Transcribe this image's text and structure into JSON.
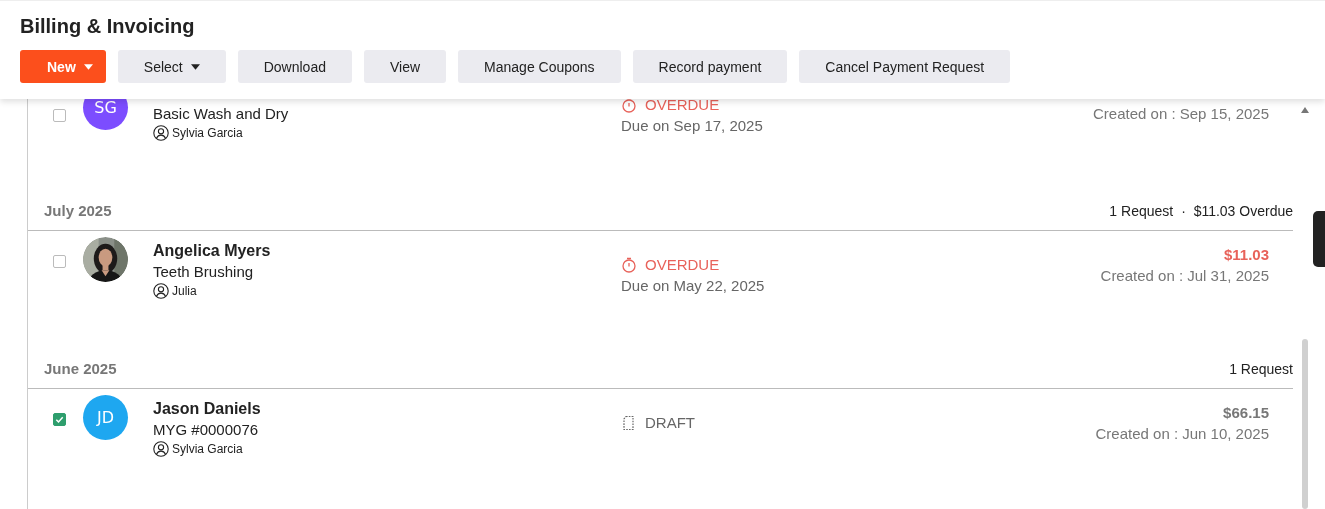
{
  "title": "Billing & Invoicing",
  "buttons": [
    {
      "label": "New",
      "kind": "primary"
    },
    {
      "label": "Select",
      "kind": "dropdown"
    },
    {
      "label": "Download",
      "kind": "plain"
    },
    {
      "label": "View",
      "kind": "plain"
    },
    {
      "label": "Manage Coupons",
      "kind": "plain"
    },
    {
      "label": "Record payment",
      "kind": "plain"
    },
    {
      "label": "Cancel Payment Request",
      "kind": "plain"
    }
  ],
  "leading_items": [
    {
      "checked": false,
      "avatar": {
        "kind": "initials",
        "initials": "SG",
        "color": "#7c4dff"
      },
      "service": "Basic Wash and Dry",
      "assignee": "Sylvia Garcia",
      "status": {
        "kind": "overdue",
        "label": "OVERDUE"
      },
      "due": "Due on Sep 17, 2025",
      "created": "Created on : Sep 15, 2025"
    }
  ],
  "groups": [
    {
      "month": "July 2025",
      "count": "1 Request",
      "overdue": "·  $11.03 Overdue",
      "items": [
        {
          "checked": false,
          "name": "Angelica Myers",
          "service": "Teeth Brushing",
          "assignee": "Julia",
          "status": {
            "kind": "overdue",
            "label": "OVERDUE"
          },
          "due": "Due on May 22, 2025",
          "amount": "$11.03",
          "created": "Created on : Jul 31, 2025"
        }
      ]
    },
    {
      "month": "June 2025",
      "count": "1 Request",
      "items": [
        {
          "checked": true,
          "avatar": {
            "kind": "initials",
            "initials": "JD",
            "color": "#1ea7f0"
          },
          "name": "Jason Daniels",
          "service": "MYG #0000076",
          "assignee": "Sylvia Garcia",
          "status": {
            "kind": "draft",
            "label": "DRAFT"
          },
          "amount": "$66.15",
          "created": "Created on : Jun 10, 2025"
        }
      ]
    }
  ]
}
